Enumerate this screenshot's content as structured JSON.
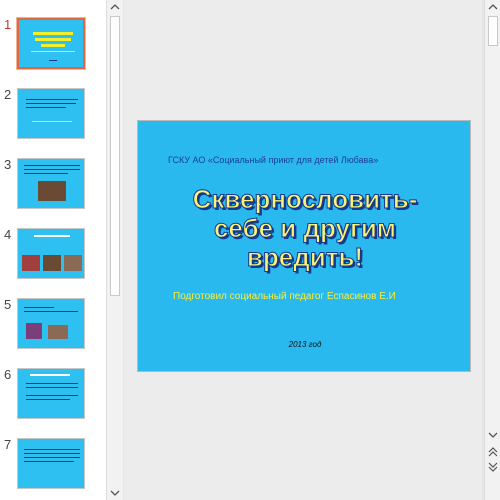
{
  "slides": [
    {
      "number": "1"
    },
    {
      "number": "2"
    },
    {
      "number": "3"
    },
    {
      "number": "4"
    },
    {
      "number": "5"
    },
    {
      "number": "6"
    },
    {
      "number": "7"
    }
  ],
  "current_slide": {
    "org": "ГСКУ АО  «Социальный приют для детей Любава»",
    "title_line1": "Сквернословить-",
    "title_line2": "себе и другим",
    "title_line3": "вредить!",
    "author": "Подготовил социальный педагог Еспасинов Е.И",
    "year": "2013 год"
  },
  "colors": {
    "slide_background": "#29b9ef",
    "title_fill": "#fbf27a",
    "title_outline": "#173a8a",
    "author_text": "#f6ef3b",
    "selection_border": "#e0673e"
  }
}
